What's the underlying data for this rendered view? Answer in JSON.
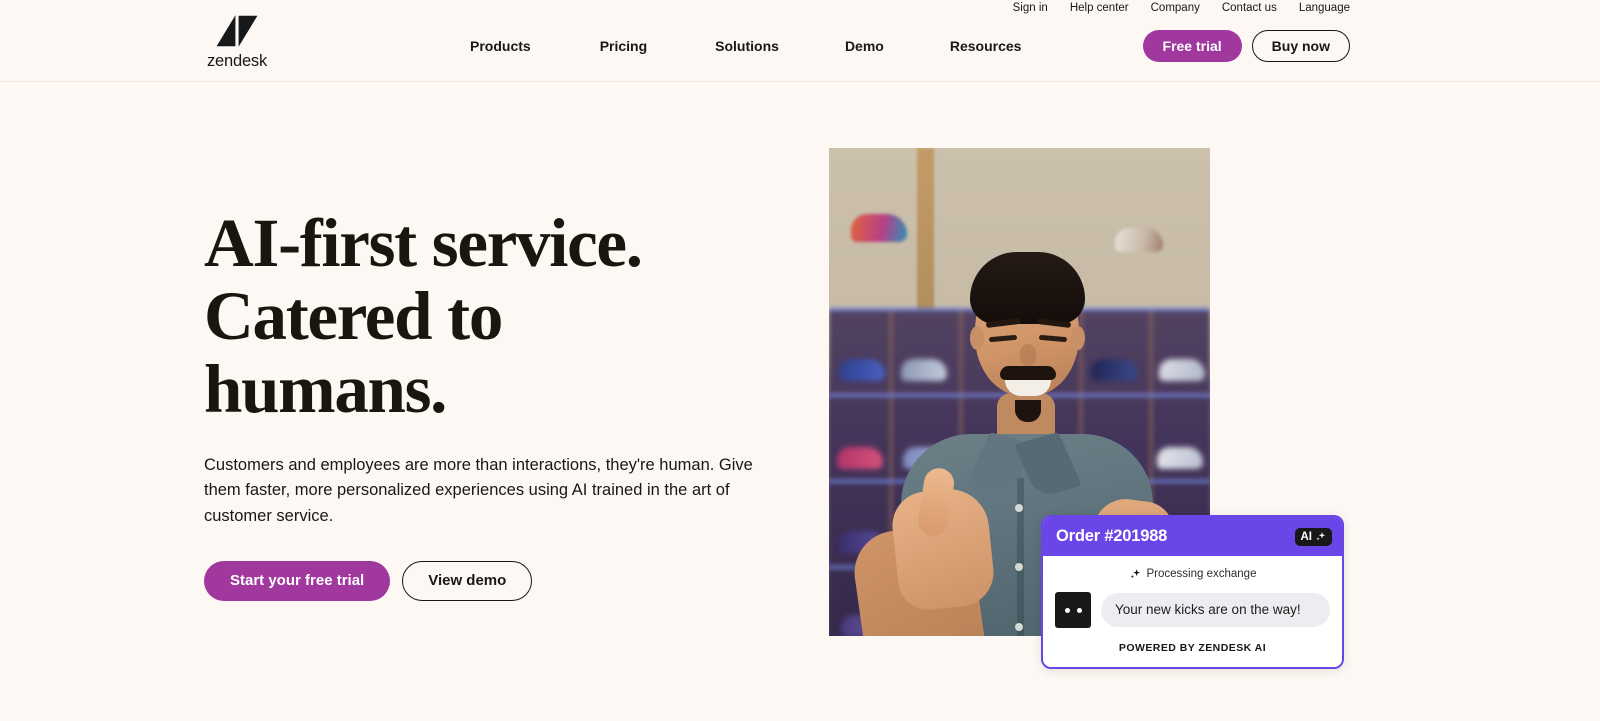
{
  "brand": {
    "name": "zendesk",
    "logo_icon": "zendesk-z-mark",
    "accent_magenta": "#a0389e",
    "accent_purple": "#6a46e8",
    "page_background": "#fdf8f3",
    "text_color": "#1b1715"
  },
  "utility_nav": {
    "items": [
      {
        "label": "Sign in"
      },
      {
        "label": "Help center"
      },
      {
        "label": "Company"
      },
      {
        "label": "Contact us"
      },
      {
        "label": "Language"
      }
    ]
  },
  "main_nav": {
    "items": [
      {
        "label": "Products"
      },
      {
        "label": "Pricing"
      },
      {
        "label": "Solutions"
      },
      {
        "label": "Demo"
      },
      {
        "label": "Resources"
      }
    ]
  },
  "header_actions": {
    "free_trial_label": "Free trial",
    "buy_now_label": "Buy now"
  },
  "hero": {
    "title_line_1": "AI-first service.",
    "title_line_2": "Catered to",
    "title_line_3": "humans.",
    "subtitle": "Customers and employees are more than interactions, they're human. Give them faster, more personalized experiences using AI trained in the art of customer service.",
    "primary_cta": "Start your free trial",
    "secondary_cta": "View demo",
    "image_alt": "Smiling man gesturing toward the camera in a sneaker store with illuminated shelves"
  },
  "ai_card": {
    "order_title": "Order #201988",
    "badge_label": "AI",
    "badge_icon": "sparkle-icon",
    "status_text": "Processing exchange",
    "status_icon": "sparkle-icon",
    "avatar_icon": "bot-face-icon",
    "message": "Your new kicks are on the way!",
    "footer": "POWERED BY ZENDESK AI"
  }
}
